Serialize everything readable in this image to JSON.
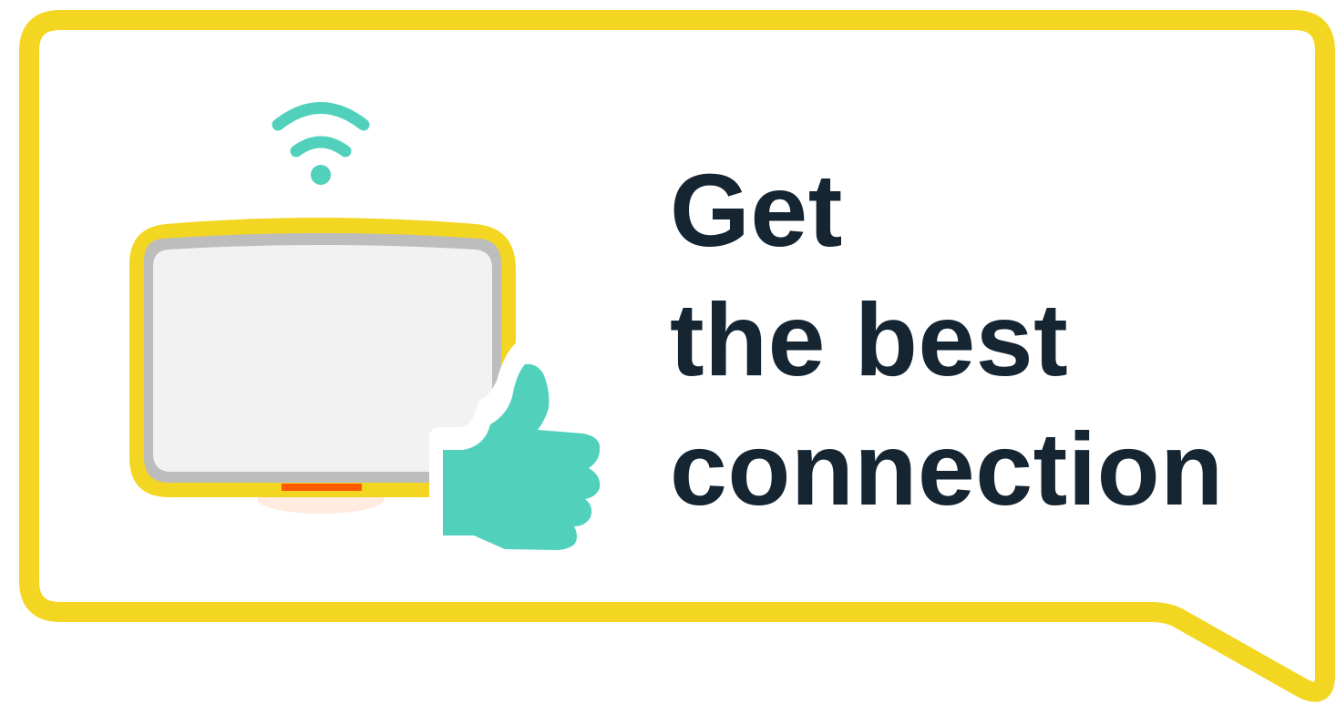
{
  "headline": {
    "line1": "Get",
    "line2": "the best",
    "line3": "connection"
  },
  "icons": {
    "wifi": "wifi-icon",
    "device": "tablet-device-icon",
    "thumbs_up": "thumbs-up-icon"
  },
  "colors": {
    "bubble_border": "#F2D622",
    "headline_text": "#152532",
    "accent_teal": "#51D1BC",
    "device_screen": "#F2F2F2",
    "device_bezel": "#BDBDBD",
    "indicator": "#FF5A00",
    "background": "#FFFFFF"
  }
}
